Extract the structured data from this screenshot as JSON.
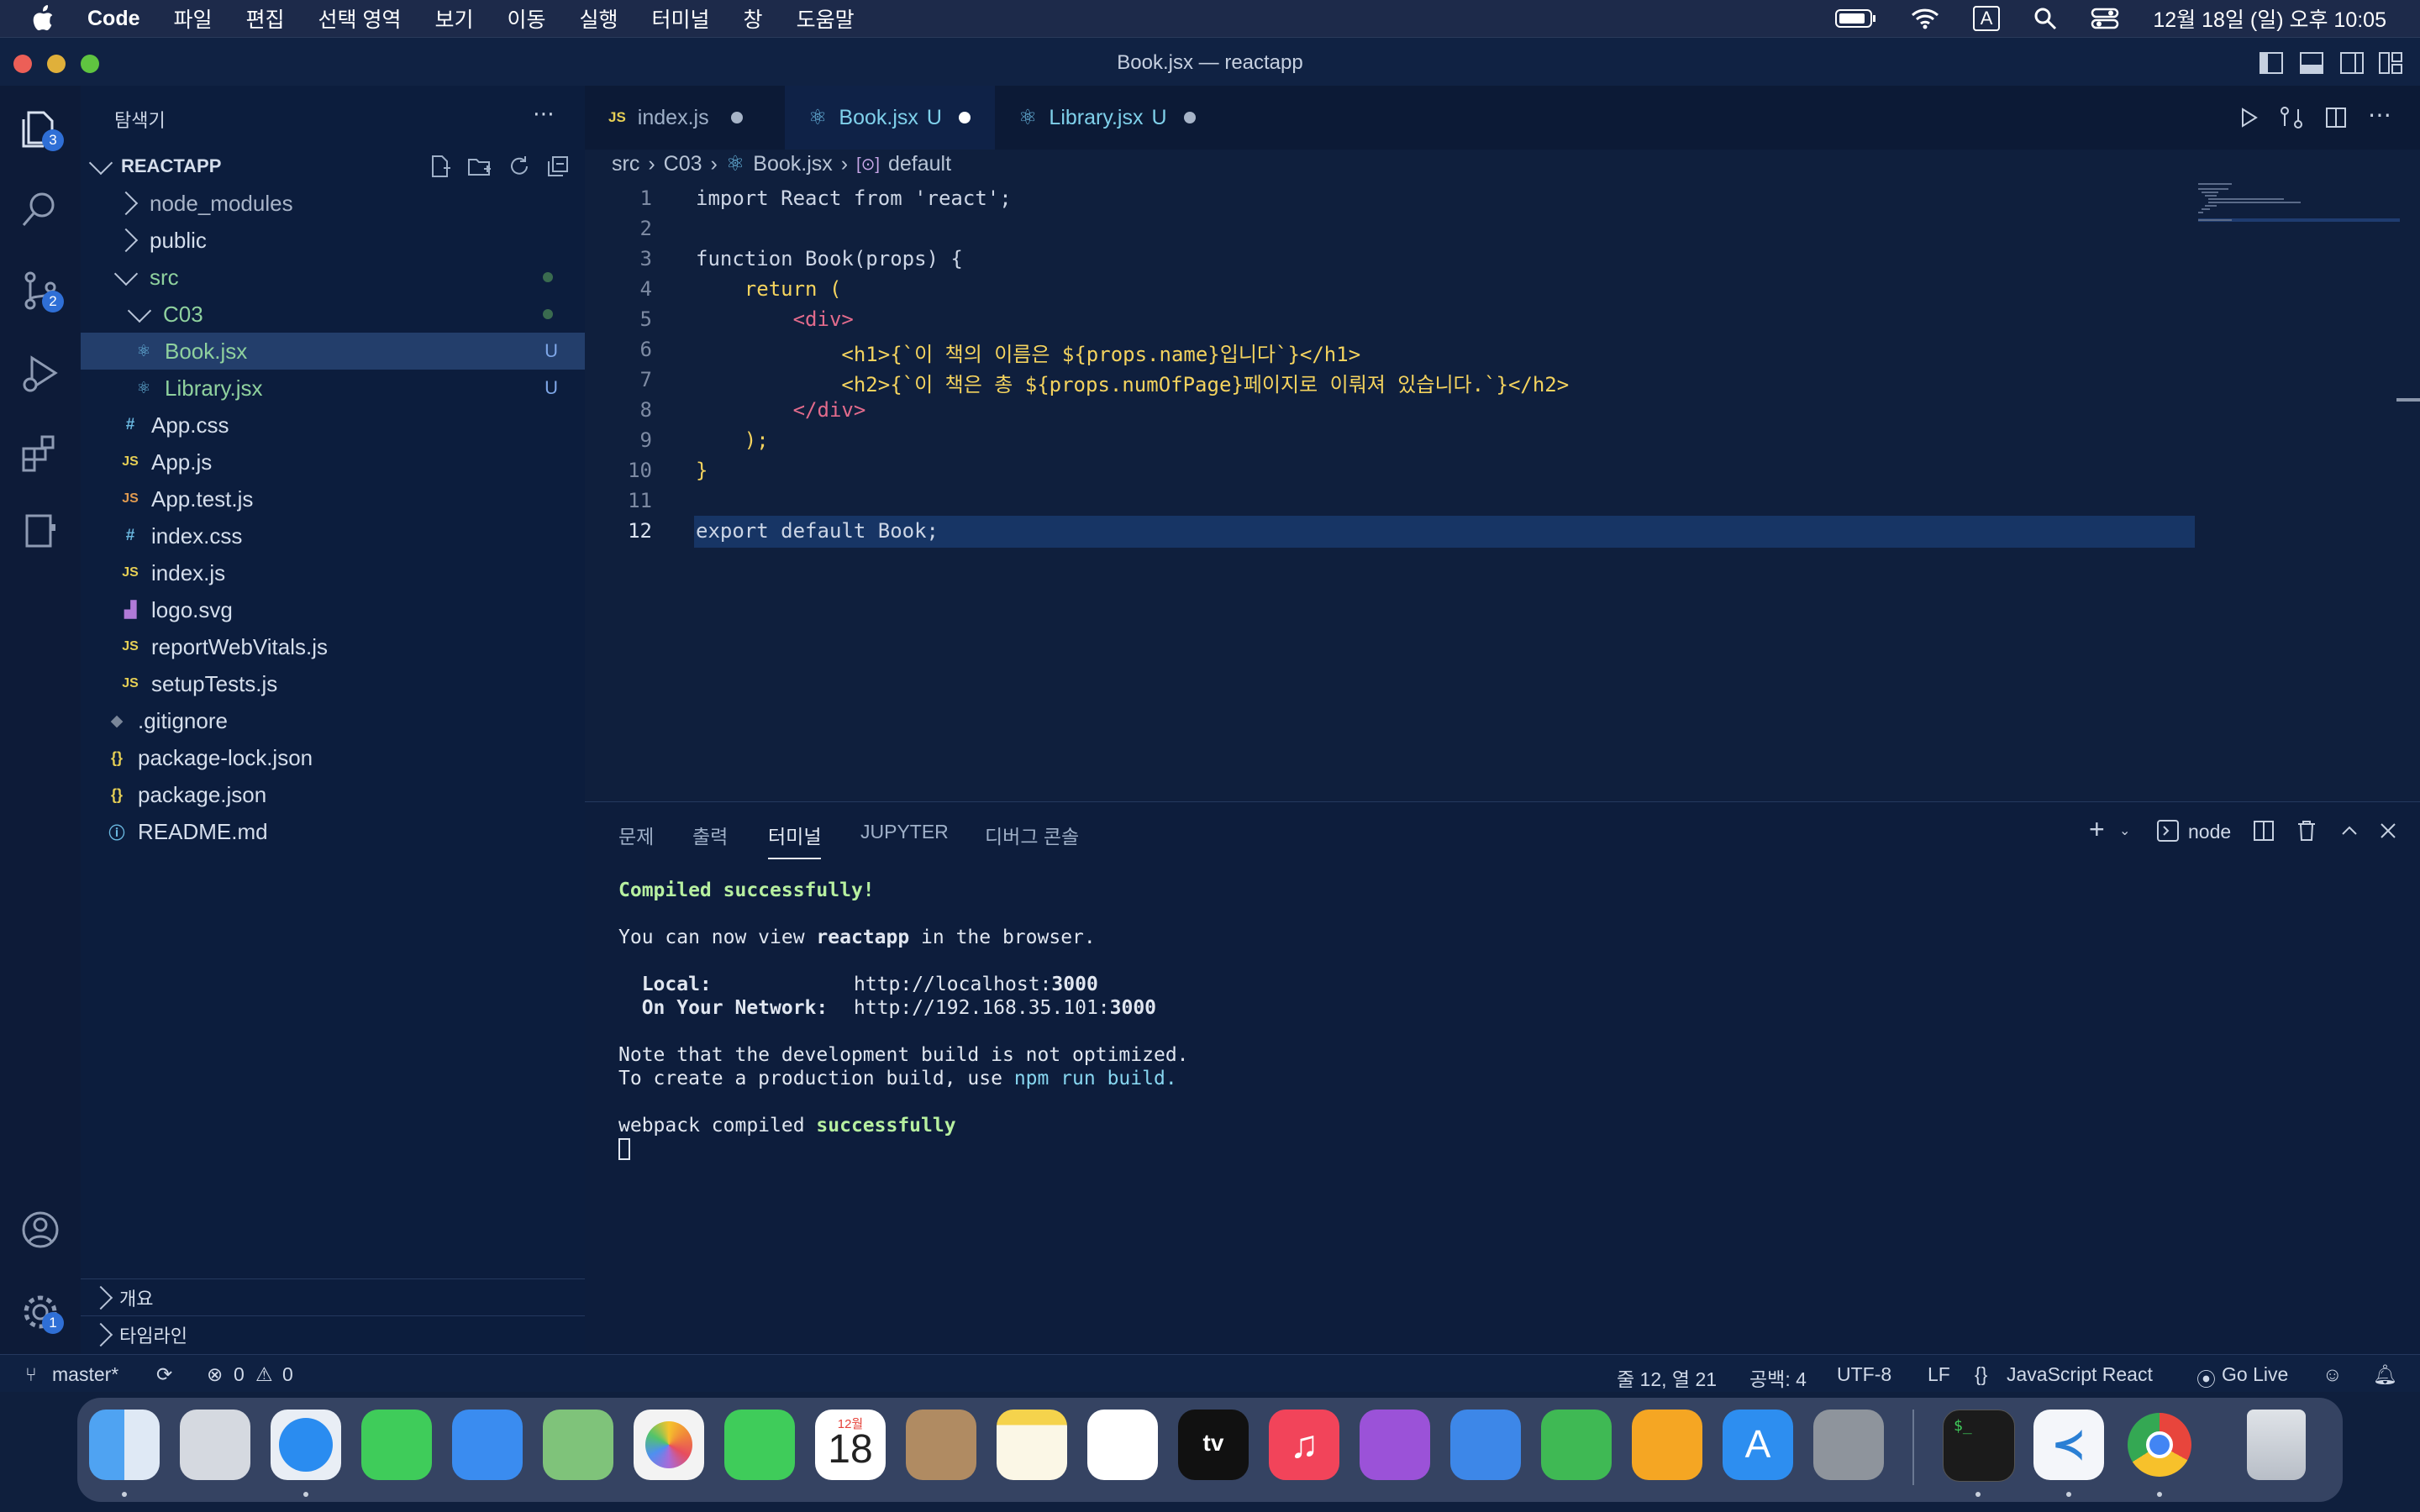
{
  "menubar": {
    "app": "Code",
    "items": [
      "파일",
      "편집",
      "선택 영역",
      "보기",
      "이동",
      "실행",
      "터미널",
      "창",
      "도움말"
    ],
    "input_indicator": "A",
    "datetime": "12월 18일 (일) 오후 10:05"
  },
  "window": {
    "title": "Book.jsx — reactapp"
  },
  "activity_badges": {
    "explorer": "3",
    "scm": "2",
    "settings": "1"
  },
  "sidebar": {
    "title": "탐색기",
    "project": "REACTAPP",
    "tree": [
      {
        "label": "node_modules",
        "kind": "folder-closed",
        "depth": 1
      },
      {
        "label": "public",
        "kind": "folder-closed",
        "depth": 1
      },
      {
        "label": "src",
        "kind": "folder-open",
        "depth": 1
      },
      {
        "label": "C03",
        "kind": "folder-open",
        "depth": 2
      },
      {
        "label": "Book.jsx",
        "kind": "react",
        "depth": 3,
        "status": "U",
        "selected": true
      },
      {
        "label": "Library.jsx",
        "kind": "react",
        "depth": 3,
        "status": "U"
      },
      {
        "label": "App.css",
        "kind": "css",
        "depth": 2
      },
      {
        "label": "App.js",
        "kind": "js",
        "depth": 2
      },
      {
        "label": "App.test.js",
        "kind": "js",
        "depth": 2
      },
      {
        "label": "index.css",
        "kind": "css",
        "depth": 2
      },
      {
        "label": "index.js",
        "kind": "js",
        "depth": 2
      },
      {
        "label": "logo.svg",
        "kind": "svg",
        "depth": 2
      },
      {
        "label": "reportWebVitals.js",
        "kind": "js",
        "depth": 2
      },
      {
        "label": "setupTests.js",
        "kind": "js",
        "depth": 2
      },
      {
        "label": ".gitignore",
        "kind": "git",
        "depth": 1
      },
      {
        "label": "package-lock.json",
        "kind": "json",
        "depth": 1
      },
      {
        "label": "package.json",
        "kind": "json",
        "depth": 1
      },
      {
        "label": "README.md",
        "kind": "info",
        "depth": 1
      }
    ],
    "outline": "개요",
    "timeline": "타임라인"
  },
  "tabs": [
    {
      "label": "index.js",
      "icon": "JS",
      "status": ""
    },
    {
      "label": "Book.jsx",
      "icon": "react",
      "status": "U"
    },
    {
      "label": "Library.jsx",
      "icon": "react",
      "status": "U"
    }
  ],
  "breadcrumb": [
    "src",
    "C03",
    "Book.jsx",
    "default"
  ],
  "code_lines": [
    "import React from 'react';",
    "",
    "function Book(props) {",
    "    return (",
    "        <div>",
    "            <h1>{`이 책의 이름은 ${props.name}입니다`}</h1>",
    "            <h2>{`이 책은 총 ${props.numOfPage}페이지로 이뤄져 있습니다.`}</h2>",
    "        </div>",
    "    );",
    "}",
    "",
    "export default Book;"
  ],
  "panel": {
    "tabs": [
      "문제",
      "출력",
      "터미널",
      "JUPYTER",
      "디버그 콘솔"
    ],
    "active_tab": "터미널",
    "shell": "node"
  },
  "terminal": {
    "compiled": "Compiled successfully!",
    "view_prefix": "You can now view ",
    "view_app": "reactapp",
    "view_suffix": " in the browser.",
    "local_label": "  Local:",
    "local_url_prefix": "http://localhost:",
    "local_port": "3000",
    "network_label": "  On Your Network:",
    "network_url_prefix": "http://192.168.35.101:",
    "network_port": "3000",
    "note1": "Note that the development build is not optimized.",
    "note2_prefix": "To create a production build, use ",
    "note2_cmd": "npm run build",
    "note2_suffix": ".",
    "webpack_prefix": "webpack compiled ",
    "webpack_status": "successfully"
  },
  "statusbar": {
    "branch": "master*",
    "errors": "0",
    "warnings": "0",
    "position": "줄 12, 열 21",
    "spaces": "공백: 4",
    "encoding": "UTF-8",
    "eol": "LF",
    "language": "JavaScript React",
    "golive": "Go Live"
  },
  "dock": {
    "calendar_month": "12월",
    "calendar_day": "18",
    "apps": [
      "finder-icon",
      "launchpad-icon",
      "safari-icon",
      "messages-icon",
      "mail-icon",
      "maps-icon",
      "photos-icon",
      "facetime-icon",
      "calendar-icon",
      "contacts-icon",
      "notes-icon",
      "reminders-icon",
      "appletv-icon",
      "music-icon",
      "podcasts-icon",
      "keynote-icon",
      "numbers-icon",
      "pages-icon",
      "appstore-icon",
      "settings-icon",
      "terminal-icon",
      "vscode-icon",
      "chrome-icon",
      "trash-icon"
    ]
  }
}
